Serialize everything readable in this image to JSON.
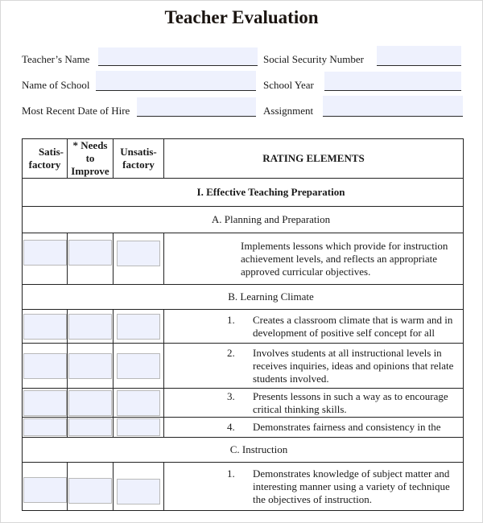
{
  "title": "Teacher Evaluation",
  "fields": {
    "teacher_name": {
      "label": "Teacher’s Name",
      "value": ""
    },
    "ssn": {
      "label": "Social Security Number",
      "value": ""
    },
    "school_name": {
      "label": "Name of School",
      "value": ""
    },
    "school_year": {
      "label": "School Year",
      "value": ""
    },
    "hire_date": {
      "label": "Most Recent Date of Hire",
      "value": ""
    },
    "assignment": {
      "label": "Assignment",
      "value": ""
    }
  },
  "table": {
    "headers": {
      "satisfactory_1": "Satis-",
      "satisfactory_2": "factory",
      "needs_1": "* Needs to",
      "needs_2": "Improve",
      "unsat_1": "Unsatis-",
      "unsat_2": "factory",
      "rating": "RATING ELEMENTS"
    },
    "section_I": "I.  Effective Teaching Preparation",
    "subsection_A": "A. Planning and Preparation",
    "A_items": [
      {
        "text": "Implements lessons which provide for instruction achievement levels,  and reflects an appropriate approved curricular objectives."
      }
    ],
    "subsection_B": "B. Learning Climate",
    "B_items": [
      {
        "num": "1.",
        "text": "Creates a classroom climate that is warm and in development of positive self concept for all"
      },
      {
        "num": "2.",
        "text": "Involves students at all instructional levels in receives inquiries, ideas and opinions that relate students involved."
      },
      {
        "num": "3.",
        "text": "Presents lessons in such a way as to encourage critical thinking skills."
      },
      {
        "num": "4.",
        "text": "Demonstrates fairness and consistency in the"
      }
    ],
    "subsection_C": "C. Instruction",
    "C_items": [
      {
        "num": "1.",
        "text": "Demonstrates knowledge of subject matter and interesting manner using a variety of technique the objectives of instruction."
      }
    ]
  },
  "colors": {
    "field_fill": "#eef1fd",
    "border": "#222222"
  }
}
